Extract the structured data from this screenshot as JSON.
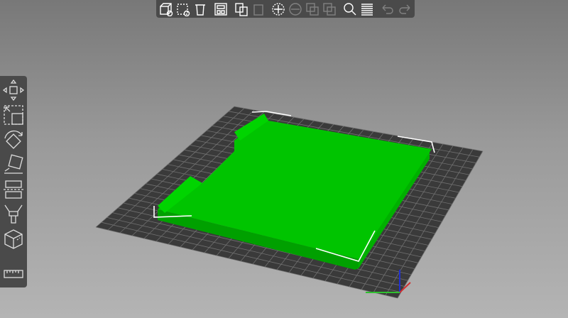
{
  "top_toolbar": {
    "items": [
      {
        "icon": "add-icon",
        "enabled": true
      },
      {
        "icon": "delete-icon",
        "enabled": true
      },
      {
        "icon": "delete-all-icon",
        "enabled": true
      },
      {
        "icon": "arrange-icon",
        "enabled": true
      },
      {
        "icon": "copy-icon",
        "enabled": true
      },
      {
        "icon": "paste-icon",
        "enabled": false
      },
      {
        "icon": "add-instance-icon",
        "enabled": true
      },
      {
        "icon": "remove-instance-icon",
        "enabled": false
      },
      {
        "icon": "split-objects-icon",
        "enabled": false
      },
      {
        "icon": "split-parts-icon",
        "enabled": false
      },
      {
        "icon": "search-icon",
        "enabled": true
      },
      {
        "icon": "layers-icon",
        "enabled": true
      },
      {
        "icon": "undo-icon",
        "enabled": false
      },
      {
        "icon": "redo-icon",
        "enabled": false
      }
    ]
  },
  "left_toolbar": {
    "items": [
      "move-icon",
      "scale-icon",
      "rotate-icon",
      "place-on-face-icon",
      "cut-icon",
      "paint-supports-icon",
      "seam-icon",
      "measure-icon"
    ]
  },
  "colors": {
    "bed": "#3a3a3a",
    "grid": "#6a6a6a",
    "part": "#00c000",
    "part_side": "#00a800",
    "bbox": "#ffffff",
    "axis_x": "#e03030",
    "axis_y": "#30c030",
    "axis_z": "#3030e0"
  }
}
